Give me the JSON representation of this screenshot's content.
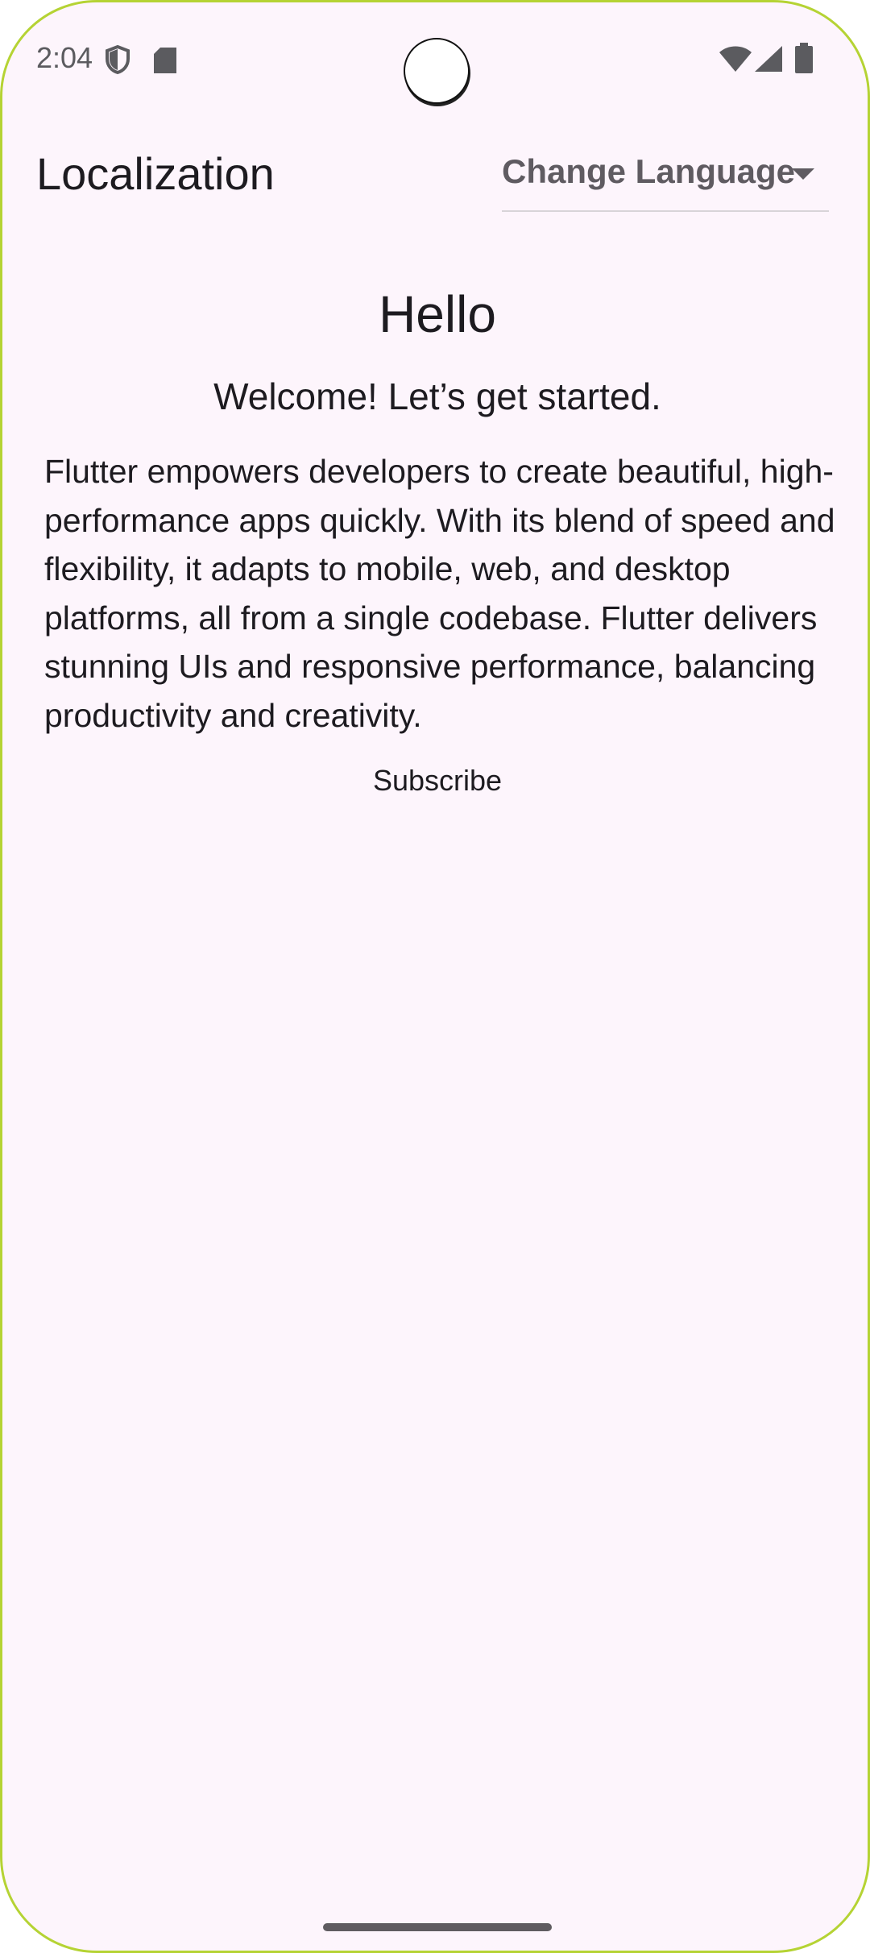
{
  "status_bar": {
    "time": "2:04",
    "left_icons": [
      "shield-icon",
      "sd-card-icon"
    ],
    "right_icons": [
      "wifi-icon",
      "cell-signal-icon",
      "battery-icon"
    ]
  },
  "app_bar": {
    "title": "Localization",
    "language_dropdown_label": "Change Language"
  },
  "content": {
    "greeting": "Hello",
    "welcome": "Welcome! Let’s get started.",
    "description": "Flutter empowers developers to create beautiful, high-performance apps quickly. With its blend of speed and flexibility, it adapts to mobile, web, and desktop platforms, all from a single codebase. Flutter delivers stunning UIs and responsive performance, balancing productivity and creativity.",
    "subscribe_label": "Subscribe"
  },
  "colors": {
    "background": "#fdf5fc",
    "frame_border": "#b5d334",
    "text_primary": "#1d1b20",
    "text_secondary": "#5f5b61"
  }
}
